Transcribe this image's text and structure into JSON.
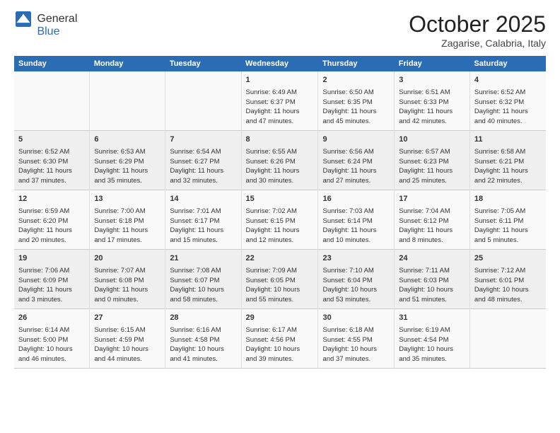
{
  "header": {
    "logo_general": "General",
    "logo_blue": "Blue",
    "month_title": "October 2025",
    "subtitle": "Zagarise, Calabria, Italy"
  },
  "weekdays": [
    "Sunday",
    "Monday",
    "Tuesday",
    "Wednesday",
    "Thursday",
    "Friday",
    "Saturday"
  ],
  "rows": [
    [
      {
        "day": "",
        "text": ""
      },
      {
        "day": "",
        "text": ""
      },
      {
        "day": "",
        "text": ""
      },
      {
        "day": "1",
        "text": "Sunrise: 6:49 AM\nSunset: 6:37 PM\nDaylight: 11 hours\nand 47 minutes."
      },
      {
        "day": "2",
        "text": "Sunrise: 6:50 AM\nSunset: 6:35 PM\nDaylight: 11 hours\nand 45 minutes."
      },
      {
        "day": "3",
        "text": "Sunrise: 6:51 AM\nSunset: 6:33 PM\nDaylight: 11 hours\nand 42 minutes."
      },
      {
        "day": "4",
        "text": "Sunrise: 6:52 AM\nSunset: 6:32 PM\nDaylight: 11 hours\nand 40 minutes."
      }
    ],
    [
      {
        "day": "5",
        "text": "Sunrise: 6:52 AM\nSunset: 6:30 PM\nDaylight: 11 hours\nand 37 minutes."
      },
      {
        "day": "6",
        "text": "Sunrise: 6:53 AM\nSunset: 6:29 PM\nDaylight: 11 hours\nand 35 minutes."
      },
      {
        "day": "7",
        "text": "Sunrise: 6:54 AM\nSunset: 6:27 PM\nDaylight: 11 hours\nand 32 minutes."
      },
      {
        "day": "8",
        "text": "Sunrise: 6:55 AM\nSunset: 6:26 PM\nDaylight: 11 hours\nand 30 minutes."
      },
      {
        "day": "9",
        "text": "Sunrise: 6:56 AM\nSunset: 6:24 PM\nDaylight: 11 hours\nand 27 minutes."
      },
      {
        "day": "10",
        "text": "Sunrise: 6:57 AM\nSunset: 6:23 PM\nDaylight: 11 hours\nand 25 minutes."
      },
      {
        "day": "11",
        "text": "Sunrise: 6:58 AM\nSunset: 6:21 PM\nDaylight: 11 hours\nand 22 minutes."
      }
    ],
    [
      {
        "day": "12",
        "text": "Sunrise: 6:59 AM\nSunset: 6:20 PM\nDaylight: 11 hours\nand 20 minutes."
      },
      {
        "day": "13",
        "text": "Sunrise: 7:00 AM\nSunset: 6:18 PM\nDaylight: 11 hours\nand 17 minutes."
      },
      {
        "day": "14",
        "text": "Sunrise: 7:01 AM\nSunset: 6:17 PM\nDaylight: 11 hours\nand 15 minutes."
      },
      {
        "day": "15",
        "text": "Sunrise: 7:02 AM\nSunset: 6:15 PM\nDaylight: 11 hours\nand 12 minutes."
      },
      {
        "day": "16",
        "text": "Sunrise: 7:03 AM\nSunset: 6:14 PM\nDaylight: 11 hours\nand 10 minutes."
      },
      {
        "day": "17",
        "text": "Sunrise: 7:04 AM\nSunset: 6:12 PM\nDaylight: 11 hours\nand 8 minutes."
      },
      {
        "day": "18",
        "text": "Sunrise: 7:05 AM\nSunset: 6:11 PM\nDaylight: 11 hours\nand 5 minutes."
      }
    ],
    [
      {
        "day": "19",
        "text": "Sunrise: 7:06 AM\nSunset: 6:09 PM\nDaylight: 11 hours\nand 3 minutes."
      },
      {
        "day": "20",
        "text": "Sunrise: 7:07 AM\nSunset: 6:08 PM\nDaylight: 11 hours\nand 0 minutes."
      },
      {
        "day": "21",
        "text": "Sunrise: 7:08 AM\nSunset: 6:07 PM\nDaylight: 10 hours\nand 58 minutes."
      },
      {
        "day": "22",
        "text": "Sunrise: 7:09 AM\nSunset: 6:05 PM\nDaylight: 10 hours\nand 55 minutes."
      },
      {
        "day": "23",
        "text": "Sunrise: 7:10 AM\nSunset: 6:04 PM\nDaylight: 10 hours\nand 53 minutes."
      },
      {
        "day": "24",
        "text": "Sunrise: 7:11 AM\nSunset: 6:03 PM\nDaylight: 10 hours\nand 51 minutes."
      },
      {
        "day": "25",
        "text": "Sunrise: 7:12 AM\nSunset: 6:01 PM\nDaylight: 10 hours\nand 48 minutes."
      }
    ],
    [
      {
        "day": "26",
        "text": "Sunrise: 6:14 AM\nSunset: 5:00 PM\nDaylight: 10 hours\nand 46 minutes."
      },
      {
        "day": "27",
        "text": "Sunrise: 6:15 AM\nSunset: 4:59 PM\nDaylight: 10 hours\nand 44 minutes."
      },
      {
        "day": "28",
        "text": "Sunrise: 6:16 AM\nSunset: 4:58 PM\nDaylight: 10 hours\nand 41 minutes."
      },
      {
        "day": "29",
        "text": "Sunrise: 6:17 AM\nSunset: 4:56 PM\nDaylight: 10 hours\nand 39 minutes."
      },
      {
        "day": "30",
        "text": "Sunrise: 6:18 AM\nSunset: 4:55 PM\nDaylight: 10 hours\nand 37 minutes."
      },
      {
        "day": "31",
        "text": "Sunrise: 6:19 AM\nSunset: 4:54 PM\nDaylight: 10 hours\nand 35 minutes."
      },
      {
        "day": "",
        "text": ""
      }
    ]
  ]
}
